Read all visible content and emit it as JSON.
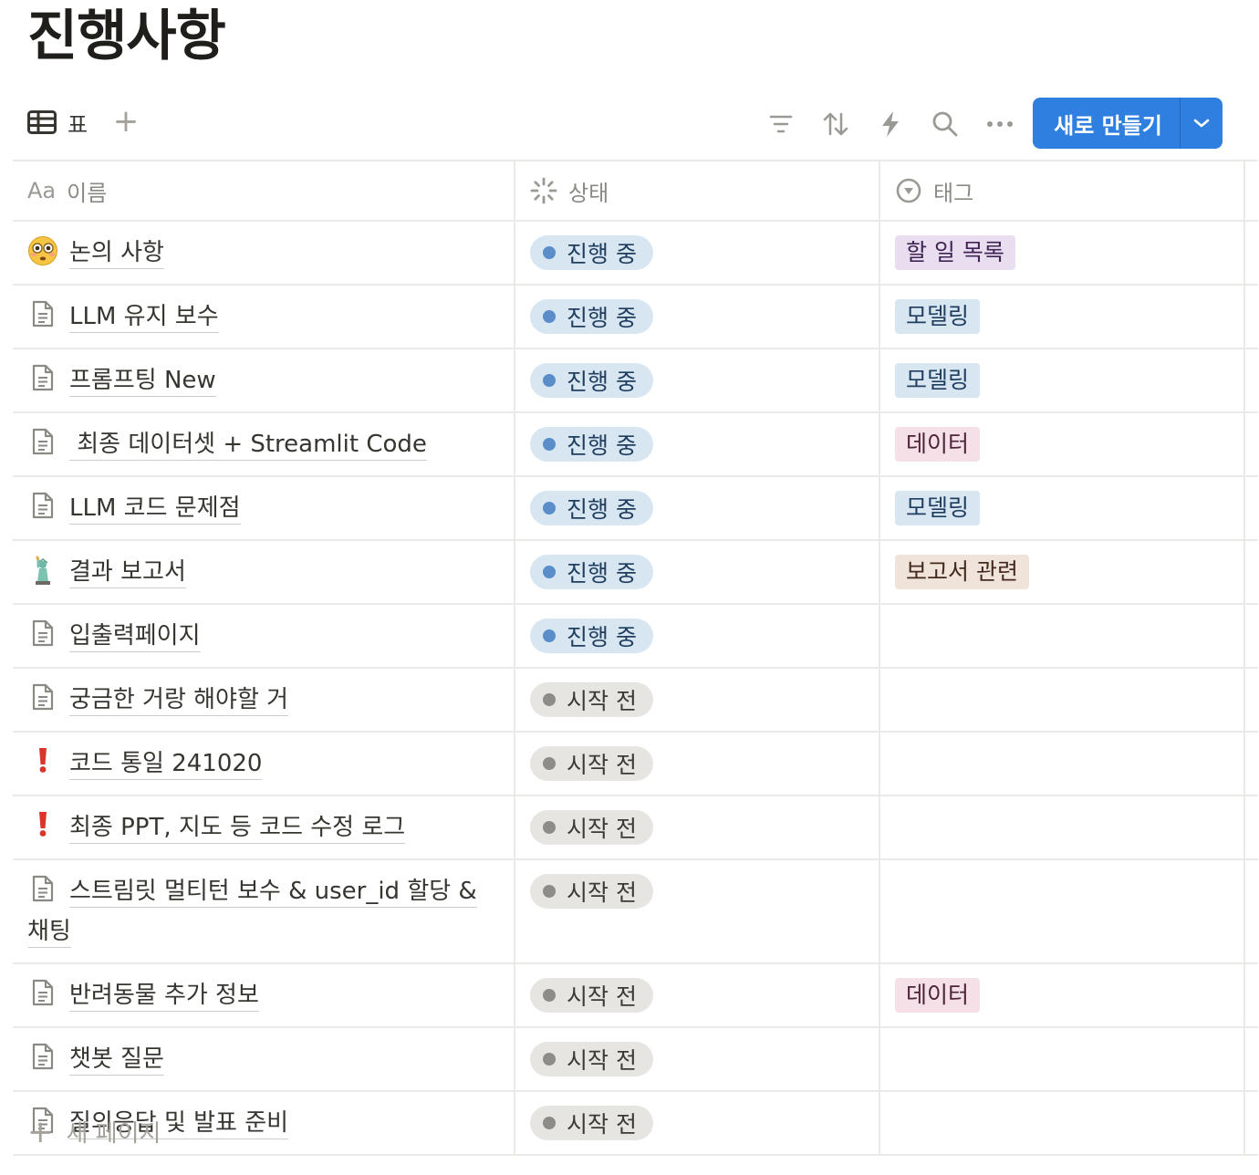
{
  "page": {
    "title": "진행사항"
  },
  "toolbar": {
    "view_tab_label": "표",
    "add_view_label": "+",
    "new_button_label": "새로 만들기"
  },
  "columns": {
    "name": "이름",
    "name_prefix": "Aa",
    "status": "상태",
    "tags": "태그"
  },
  "rows": [
    {
      "icon": "flushed-face-emoji",
      "name": "논의 사항",
      "status": "진행 중",
      "status_color": "blue",
      "tag": "할 일 목록",
      "tag_color": "purple"
    },
    {
      "icon": "page-icon",
      "name": "LLM 유지 보수",
      "status": "진행 중",
      "status_color": "blue",
      "tag": "모델링",
      "tag_color": "blue"
    },
    {
      "icon": "page-icon",
      "name": "프롬프팅 New",
      "status": "진행 중",
      "status_color": "blue",
      "tag": "모델링",
      "tag_color": "blue"
    },
    {
      "icon": "page-icon",
      "name": " 최종 데이터셋 + Streamlit Code",
      "status": "진행 중",
      "status_color": "blue",
      "tag": "데이터",
      "tag_color": "pink"
    },
    {
      "icon": "page-icon",
      "name": "LLM 코드 문제점",
      "status": "진행 중",
      "status_color": "blue",
      "tag": "모델링",
      "tag_color": "blue"
    },
    {
      "icon": "statue-of-liberty-emoji",
      "name": "결과 보고서",
      "status": "진행 중",
      "status_color": "blue",
      "tag": "보고서 관련",
      "tag_color": "brown"
    },
    {
      "icon": "page-icon",
      "name": "입출력페이지",
      "status": "진행 중",
      "status_color": "blue",
      "tag": "",
      "tag_color": ""
    },
    {
      "icon": "page-icon",
      "name": "궁금한 거랑 해야할 거",
      "status": "시작 전",
      "status_color": "gray",
      "tag": "",
      "tag_color": ""
    },
    {
      "icon": "exclamation-icon",
      "name": "코드 통일 241020",
      "status": "시작 전",
      "status_color": "gray",
      "tag": "",
      "tag_color": ""
    },
    {
      "icon": "exclamation-icon",
      "name": "최종 PPT, 지도 등 코드 수정 로그",
      "status": "시작 전",
      "status_color": "gray",
      "tag": "",
      "tag_color": ""
    },
    {
      "icon": "page-icon",
      "name": "스트림릿 멀티턴 보수  & user_id 할당 & 채팅",
      "status": "시작 전",
      "status_color": "gray",
      "tag": "",
      "tag_color": ""
    },
    {
      "icon": "page-icon",
      "name": "반려동물 추가 정보",
      "status": "시작 전",
      "status_color": "gray",
      "tag": "데이터",
      "tag_color": "pink"
    },
    {
      "icon": "page-icon",
      "name": "챗봇 질문",
      "status": "시작 전",
      "status_color": "gray",
      "tag": "",
      "tag_color": ""
    },
    {
      "icon": "page-icon",
      "name": "질의응답 및 발표 준비",
      "status": "시작 전",
      "status_color": "gray",
      "tag": "",
      "tag_color": ""
    }
  ],
  "footer": {
    "new_page_label": "새 페이지"
  }
}
